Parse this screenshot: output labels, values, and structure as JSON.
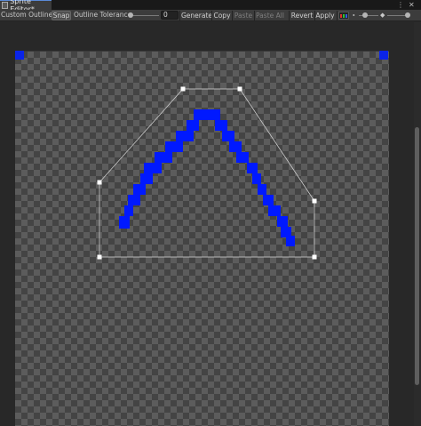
{
  "window": {
    "tab_title": "Sprite Editor*",
    "tab_icon": "sprite-editor-icon",
    "menu_glyph": "⋮",
    "close_glyph": "✕"
  },
  "toolbar": {
    "mode_dropdown": "Custom Outline",
    "snap_label": "Snap",
    "tolerance_label": "Outline Tolerance",
    "tolerance_value": "0",
    "tolerance_fraction": 0,
    "generate_label": "Generate",
    "copy_label": "Copy",
    "paste_label": "Paste",
    "paste_all_label": "Paste All",
    "revert_label": "Revert",
    "apply_label": "Apply",
    "zoom_fraction": 0.3
  },
  "colors": {
    "sprite_pixels": "#0019ff",
    "corner_markers": "#0a24e8",
    "outline": "#d8d8d8",
    "handles": "#ffffff"
  }
}
